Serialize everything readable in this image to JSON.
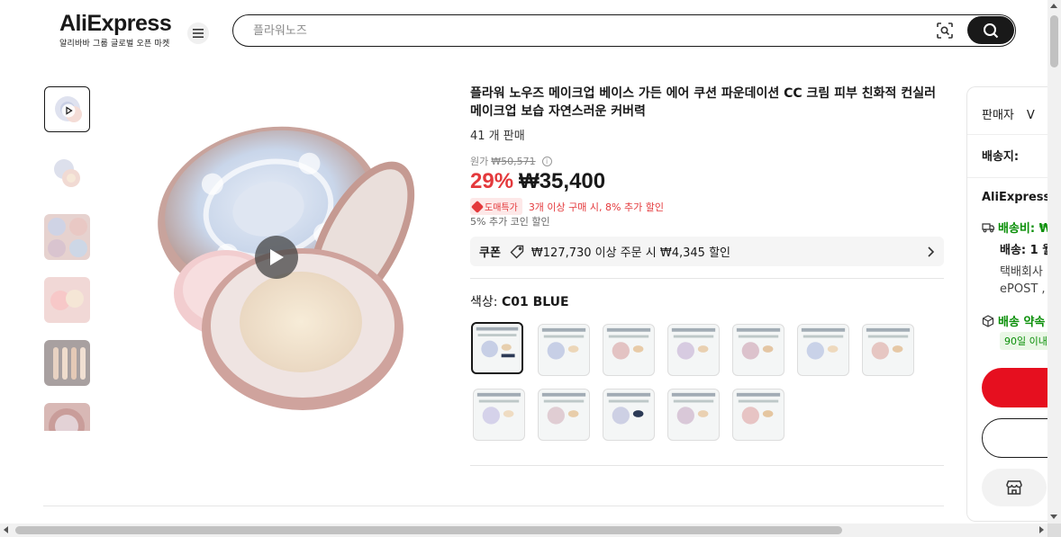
{
  "header": {
    "logo": "AliExpress",
    "logo_sub": "알리바바 그룹 글로벌 오픈 마켓",
    "search_placeholder": "플라워노즈",
    "icons": {
      "menu": "hamburger-menu-icon",
      "camera": "image-search-icon",
      "search": "search-icon"
    }
  },
  "gallery": {
    "thumbnails": [
      "video-thumb",
      "product-photo",
      "swatch-photo",
      "pink-cushion-photo",
      "skin-swatch-photo",
      "compact-photo"
    ],
    "selected_index": 0,
    "play_icon": "play-icon"
  },
  "product": {
    "title": "플라워 노우즈 메이크업 베이스 가든 에어 쿠션 파운데이션 CC 크림 피부 친화적 컨실러 메이크업 보습 자연스러운 커버력",
    "sold": "41 개 판매",
    "original_label": "원가",
    "original_price": "₩50,571",
    "discount": "29%",
    "price": "₩35,400",
    "bulk_badge": "도매특가",
    "bulk_text": "3개 이상 구매 시, 8% 추가 할인",
    "coin_text": "5% 추가 코인 할인",
    "coupon": {
      "label": "쿠폰",
      "text": "₩127,730 이상 주문 시 ₩4,345 할인"
    },
    "color_label": "색상:",
    "color_value": "C01 BLUE",
    "swatch_count": 12,
    "selected_swatch": 0
  },
  "side_card": {
    "seller_label": "판매자",
    "seller_value": "V",
    "ship_to_label": "배송지:",
    "store_name": "AliExpressS",
    "shipping_fee": "배송비: ₩",
    "delivery": "배송: 1 월",
    "courier": "택배회사",
    "epost": "ePOST ,",
    "promise": "배송 약속",
    "days": "90일 이내"
  },
  "colors": {
    "accent": "#e4393c",
    "buy": "#e60f1f",
    "green": "#0a8f08"
  }
}
